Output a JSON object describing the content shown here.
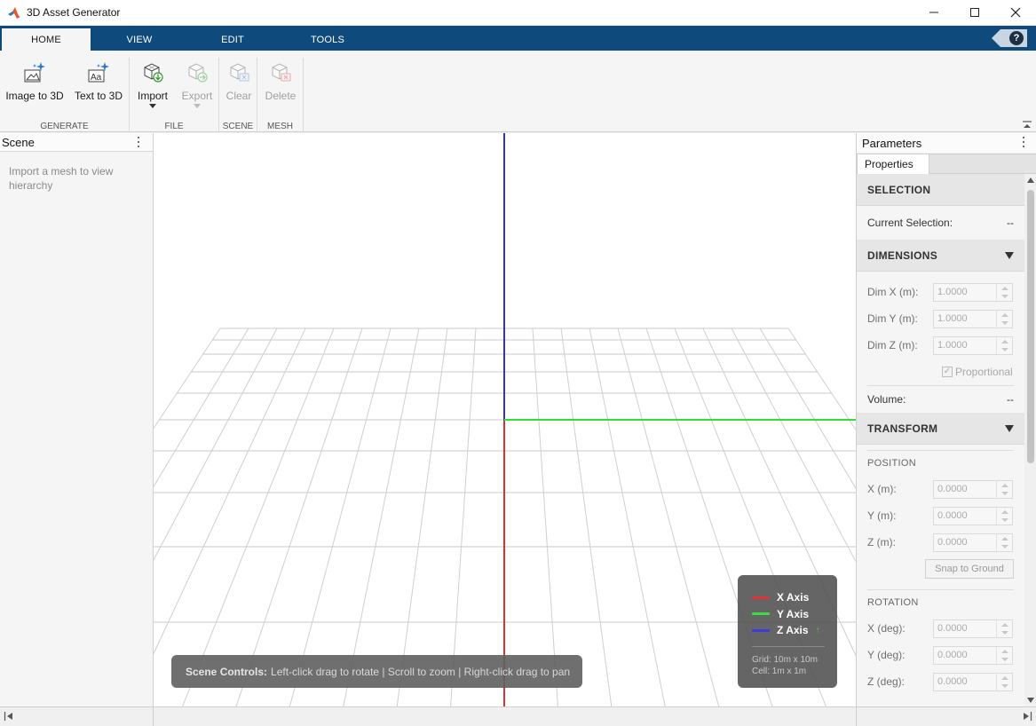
{
  "window": {
    "title": "3D Asset Generator",
    "icons": {
      "app": "matlab-logo-icon",
      "minimize": "minimize-icon",
      "maximize": "maximize-icon",
      "close": "close-icon"
    }
  },
  "tabs": [
    {
      "label": "HOME",
      "active": true
    },
    {
      "label": "VIEW",
      "active": false
    },
    {
      "label": "EDIT",
      "active": false
    },
    {
      "label": "TOOLS",
      "active": false
    }
  ],
  "help": {
    "label": "?"
  },
  "toolstrip": {
    "sections": {
      "generate": "GENERATE",
      "file": "FILE",
      "scene": "SCENE",
      "mesh": "MESH"
    },
    "buttons": {
      "image_to_3d": "Image to 3D",
      "text_to_3d": "Text to 3D",
      "import": "Import",
      "export": "Export",
      "clear": "Clear",
      "delete": "Delete"
    }
  },
  "scene_panel": {
    "title": "Scene",
    "empty_message": "Import a mesh to view hierarchy"
  },
  "viewport": {
    "axis_colors": {
      "x": "#d93030",
      "y": "#33dd33",
      "z": "#3333cc"
    },
    "legend": {
      "x_label": "X Axis",
      "y_label": "Y Axis",
      "z_label": "Z Axis",
      "z_arrow": "↑",
      "grid_info": "Grid: 10m x 10m",
      "cell_info": "Cell: 1m x 1m"
    },
    "controls_hint": {
      "title": "Scene Controls:",
      "text": "Left-click drag to rotate | Scroll to zoom | Right-click drag to pan"
    }
  },
  "params_panel": {
    "title": "Parameters",
    "tab": "Properties",
    "selection": {
      "header": "SELECTION",
      "current_label": "Current Selection:",
      "current_value": "--"
    },
    "dimensions": {
      "header": "DIMENSIONS",
      "dim_x_label": "Dim X (m):",
      "dim_x_value": "1.0000",
      "dim_y_label": "Dim Y (m):",
      "dim_y_value": "1.0000",
      "dim_z_label": "Dim Z (m):",
      "dim_z_value": "1.0000",
      "proportional_label": "Proportional",
      "proportional_checked": true,
      "volume_label": "Volume:",
      "volume_value": "--"
    },
    "transform": {
      "header": "TRANSFORM",
      "position_header": "POSITION",
      "x_label": "X (m):",
      "x_value": "0.0000",
      "y_label": "Y (m):",
      "y_value": "0.0000",
      "z_label": "Z (m):",
      "z_value": "0.0000",
      "snap_button": "Snap to Ground",
      "rotation_header": "ROTATION",
      "rx_label": "X (deg):",
      "rx_value": "0.0000",
      "ry_label": "Y (deg):",
      "ry_value": "0.0000",
      "rz_label": "Z (deg):",
      "rz_value": "0.0000"
    }
  }
}
